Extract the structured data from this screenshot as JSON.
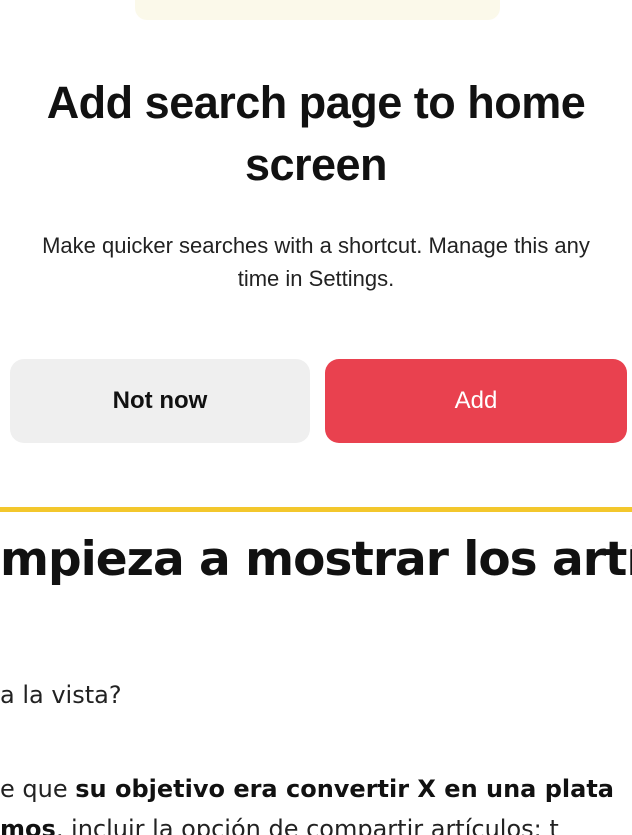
{
  "dialog": {
    "title": "Add search page to home screen",
    "description": "Make quicker searches with a shortcut. Manage this any time in Settings.",
    "not_now_label": "Not now",
    "add_label": "Add"
  },
  "article": {
    "heading": "mpieza a mostrar los artíc",
    "line1": "a la vista?",
    "line2_normal": "e que ",
    "line2_bold": "su objetivo era convertir X en una plata",
    "line3_bold": "mos",
    "line3_normal": ", incluir la opción de compartir artículos; t"
  },
  "colors": {
    "primary_button": "#e9414f",
    "secondary_button": "#efefef",
    "divider": "#f3c72c"
  }
}
